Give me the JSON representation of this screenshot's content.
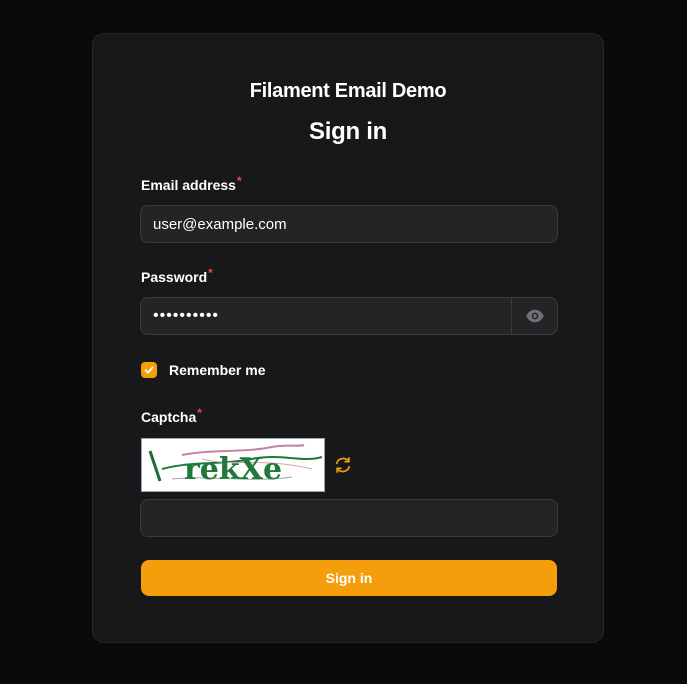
{
  "brand": {
    "name": "Filament Email Demo"
  },
  "form": {
    "heading": "Sign in",
    "email": {
      "label": "Email address",
      "required_mark": "*",
      "value": "user@example.com"
    },
    "password": {
      "label": "Password",
      "required_mark": "*",
      "masked_value": "••••••••••"
    },
    "remember": {
      "label": "Remember me",
      "checked": true
    },
    "captcha": {
      "label": "Captcha",
      "required_mark": "*",
      "image_text": "rekXe",
      "input_value": ""
    },
    "submit_label": "Sign in"
  },
  "colors": {
    "accent": "#f59e0b",
    "required": "#ef4444",
    "card": "#18181b",
    "background": "#0a0a0b"
  },
  "icons": {
    "password_toggle": "eye-icon",
    "captcha_refresh": "refresh-icon",
    "checkbox": "check-icon"
  }
}
